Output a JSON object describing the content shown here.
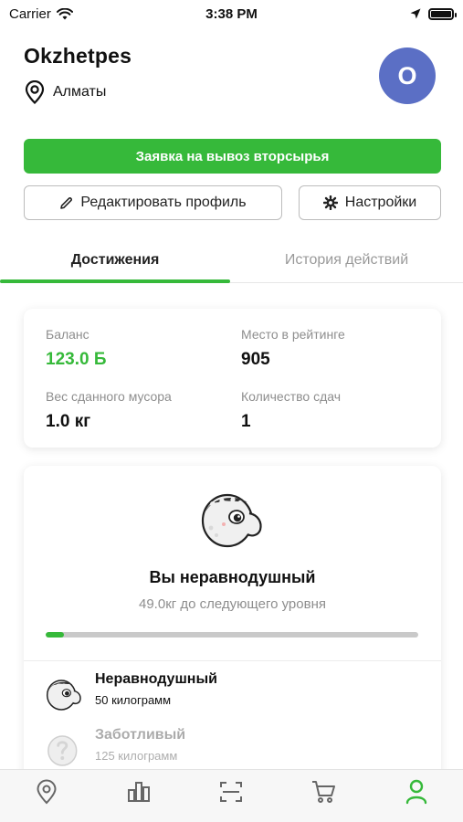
{
  "status_bar": {
    "carrier": "Carrier",
    "time": "3:38 PM"
  },
  "profile": {
    "username": "Okzhetpes",
    "city": "Алматы",
    "avatar_initial": "O"
  },
  "actions": {
    "request_label": "Заявка на вывоз вторсырья",
    "edit_label": "Редактировать профиль",
    "settings_label": "Настройки"
  },
  "tabs": [
    {
      "label": "Достижения",
      "active": true
    },
    {
      "label": "История действий",
      "active": false
    }
  ],
  "stats": {
    "balance_label": "Баланс",
    "balance_value": "123.0 Б",
    "rating_label": "Место в рейтинге",
    "rating_value": "905",
    "weight_label": "Вес сданного мусора",
    "weight_value": "1.0 кг",
    "count_label": "Количество сдач",
    "count_value": "1"
  },
  "level": {
    "title": "Вы неравнодушный",
    "subtitle": "49.0кг до следующего уровня",
    "progress": 0.05
  },
  "levels": [
    {
      "name": "Неравнодушный",
      "desc": "50 килограмм",
      "unlocked": true
    },
    {
      "name": "Заботливый",
      "desc": "125 килограмм",
      "unlocked": false
    }
  ],
  "tabbar": [
    "map-pin-icon",
    "chart-icon",
    "scan-icon",
    "cart-icon",
    "profile-icon"
  ],
  "colors": {
    "accent": "#36b93a",
    "avatar": "#5b6fc5",
    "muted": "#8e8e8e"
  }
}
